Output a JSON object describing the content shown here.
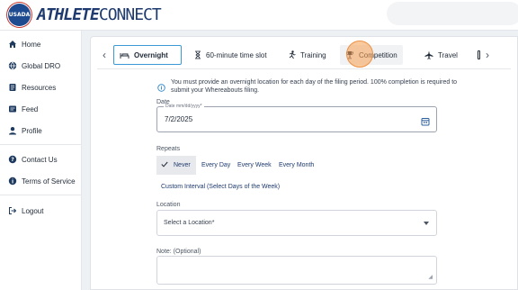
{
  "header": {
    "logo_text": "USADA",
    "brand_bold": "ATHLETE",
    "brand_light": "CONNECT"
  },
  "sidebar": {
    "items": [
      {
        "label": "Home",
        "icon": "home-icon"
      },
      {
        "label": "Global DRO",
        "icon": "globe-icon"
      },
      {
        "label": "Resources",
        "icon": "book-icon"
      },
      {
        "label": "Feed",
        "icon": "feed-icon"
      },
      {
        "label": "Profile",
        "icon": "user-icon"
      },
      {
        "label": "Contact Us",
        "icon": "help-icon"
      },
      {
        "label": "Terms of Service",
        "icon": "info-icon"
      },
      {
        "label": "Logout",
        "icon": "logout-icon"
      }
    ]
  },
  "tabs": {
    "items": [
      {
        "label": "Overnight",
        "icon": "bed-icon",
        "active": true
      },
      {
        "label": "60-minute time slot",
        "icon": "hourglass-icon"
      },
      {
        "label": "Training",
        "icon": "run-icon"
      },
      {
        "label": "Competition",
        "icon": "trophy-icon",
        "hover": true
      },
      {
        "label": "Travel",
        "icon": "plane-icon"
      }
    ]
  },
  "info": {
    "text": "You must provide an overnight location for each day of the filing period. 100% completion is required to submit your Whereabouts filing."
  },
  "date": {
    "label": "Date",
    "hint": "Date mm/dd/yyyy*",
    "value": "7/2/2025"
  },
  "repeats": {
    "label": "Repeats",
    "options": [
      "Never",
      "Every Day",
      "Every Week",
      "Every Month",
      "Custom Interval (Select Days of the Week)"
    ],
    "selected": "Never"
  },
  "location": {
    "label": "Location",
    "placeholder": "Select a Location*"
  },
  "note": {
    "label": "Note: (Optional)"
  },
  "colors": {
    "brand_blue": "#1e3a6e",
    "accent_blue": "#3b9ad6",
    "cursor_orange": "#f59e50"
  }
}
